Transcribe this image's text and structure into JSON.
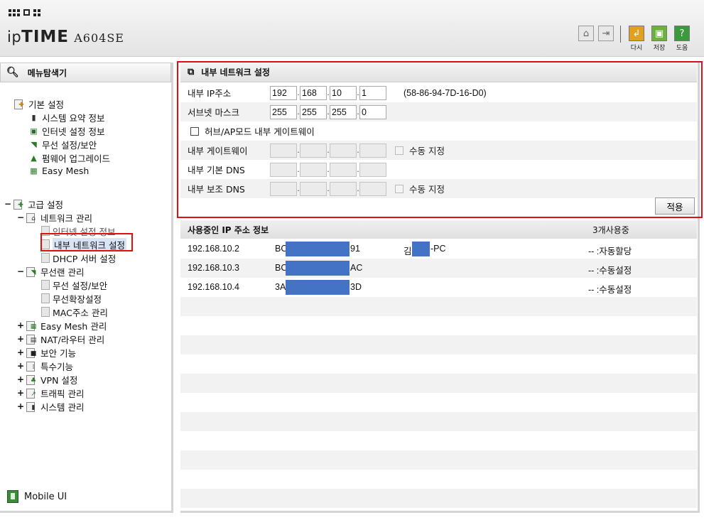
{
  "header": {
    "logo_prefix": "ip",
    "logo_brand": "TIME",
    "model": "A604SE",
    "buttons": [
      {
        "icon": "undo-icon",
        "label": "다시",
        "color": "#e0a020"
      },
      {
        "icon": "save-icon",
        "label": "저장",
        "color": "#6cb33e"
      },
      {
        "icon": "help-icon",
        "label": "도움",
        "color": "#3c9a3c"
      }
    ]
  },
  "sidebar": {
    "title": "메뉴탐색기",
    "basic": {
      "label": "기본 설정",
      "items": [
        "시스템 요약 정보",
        "인터넷 설정 정보",
        "무선 설정/보안",
        "펌웨어 업그레이드",
        "Easy Mesh"
      ]
    },
    "advanced": {
      "label": "고급 설정",
      "network": {
        "label": "네트워크 관리",
        "items": [
          "인터넷 설정 정보",
          "내부 네트워크 설정",
          "DHCP 서버 설정"
        ]
      },
      "wireless": {
        "label": "무선랜 관리",
        "items": [
          "무선 설정/보안",
          "무선확장설정",
          "MAC주소 관리"
        ]
      },
      "groups": [
        "Easy Mesh 관리",
        "NAT/라우터 관리",
        "보안 기능",
        "특수기능",
        "VPN 설정",
        "트래픽 관리",
        "시스템 관리"
      ]
    },
    "mobile_ui": "Mobile UI"
  },
  "main": {
    "title": "내부 네트워크 설정",
    "ip_label": "내부 IP주소",
    "ip": [
      "192",
      "168",
      "10",
      "1"
    ],
    "mac": "(58-86-94-7D-16-D0)",
    "subnet_label": "서브넷 마스크",
    "subnet": [
      "255",
      "255",
      "255",
      "0"
    ],
    "hub_ap_label": "허브/AP모드 내부 게이트웨이",
    "gateway_label": "내부 게이트웨이",
    "manual_label": "수동 지정",
    "dns1_label": "내부 기본 DNS",
    "dns2_label": "내부 보조 DNS",
    "manual_label2": "수동 지정",
    "apply_button": "적용"
  },
  "ip_info": {
    "title": "사용중인 IP 주소 정보",
    "count": "3개사용중",
    "rows": [
      {
        "ip": "192.168.10.2",
        "mac_start": "BC",
        "mac_end": "91",
        "name_start": "김",
        "name_end": "-PC",
        "mode": "-- :자동할당"
      },
      {
        "ip": "192.168.10.3",
        "mac_start": "BC",
        "mac_end": "AC",
        "name_start": "",
        "name_end": "",
        "mode": "-- :수동설정"
      },
      {
        "ip": "192.168.10.4",
        "mac_start": "3A",
        "mac_end": "3D",
        "name_start": "",
        "name_end": "",
        "mode": "-- :수동설정"
      }
    ]
  },
  "colors": {
    "highlight_border": "#e01010",
    "redaction": "#4472c4"
  }
}
